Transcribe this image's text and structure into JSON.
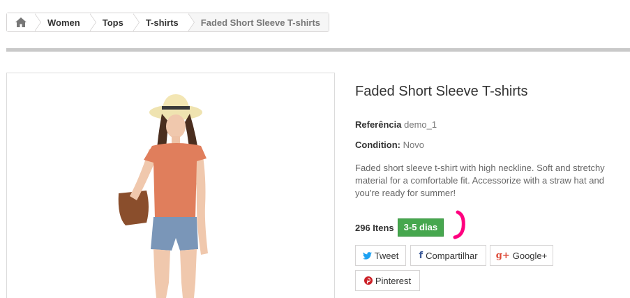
{
  "breadcrumb": {
    "home_icon": "home-icon",
    "items": [
      {
        "label": "Women"
      },
      {
        "label": "Tops"
      },
      {
        "label": "T-shirts"
      },
      {
        "label": "Faded Short Sleeve T-shirts"
      }
    ]
  },
  "product": {
    "title": "Faded Short Sleeve T-shirts",
    "reference_label": "Referência",
    "reference_value": "demo_1",
    "condition_label": "Condition:",
    "condition_value": "Novo",
    "description": "Faded short sleeve t-shirt with high neckline. Soft and stretchy material for a comfortable fit. Accessorize with a straw hat and you're ready for summer!",
    "quantity": "296 Itens",
    "availability": "3-5 dias"
  },
  "social": {
    "tweet": {
      "label": "Tweet",
      "icon": "twitter-icon"
    },
    "share": {
      "label": "Compartilhar",
      "icon": "facebook-icon"
    },
    "google": {
      "label": "Google+",
      "icon": "google-plus-icon"
    },
    "pinterest": {
      "label": "Pinterest",
      "icon": "pinterest-icon"
    }
  },
  "colors": {
    "availability_bg": "#46a74e",
    "annotation_mark": "#ff007f",
    "twitter": "#1da1f2",
    "facebook": "#3b5998",
    "google": "#dd4b39",
    "pinterest": "#cb2027"
  }
}
